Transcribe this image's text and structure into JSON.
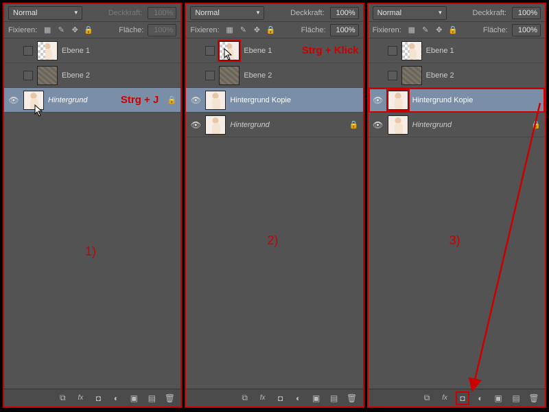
{
  "common": {
    "blend_mode": "Normal",
    "opacity_label": "Deckkraft:",
    "opacity_value": "100%",
    "fixieren_label": "Fixieren:",
    "fill_label": "Fläche:",
    "fill_value": "100%"
  },
  "layers": {
    "ebene1": "Ebene 1",
    "ebene2": "Ebene 2",
    "hintergrund": "Hintergrund",
    "hintergrund_kopie": "Hintergrund Kopie"
  },
  "annotations": {
    "panel1_key": "Strg + J",
    "panel2_key": "Strg + Klick",
    "step1": "1)",
    "step2": "2)",
    "step3": "3)"
  },
  "icons": {
    "link": "⧉",
    "fx": "fx",
    "mask": "◘",
    "adjust": "◐",
    "group": "▣",
    "new": "▤",
    "trash": "🗑"
  }
}
